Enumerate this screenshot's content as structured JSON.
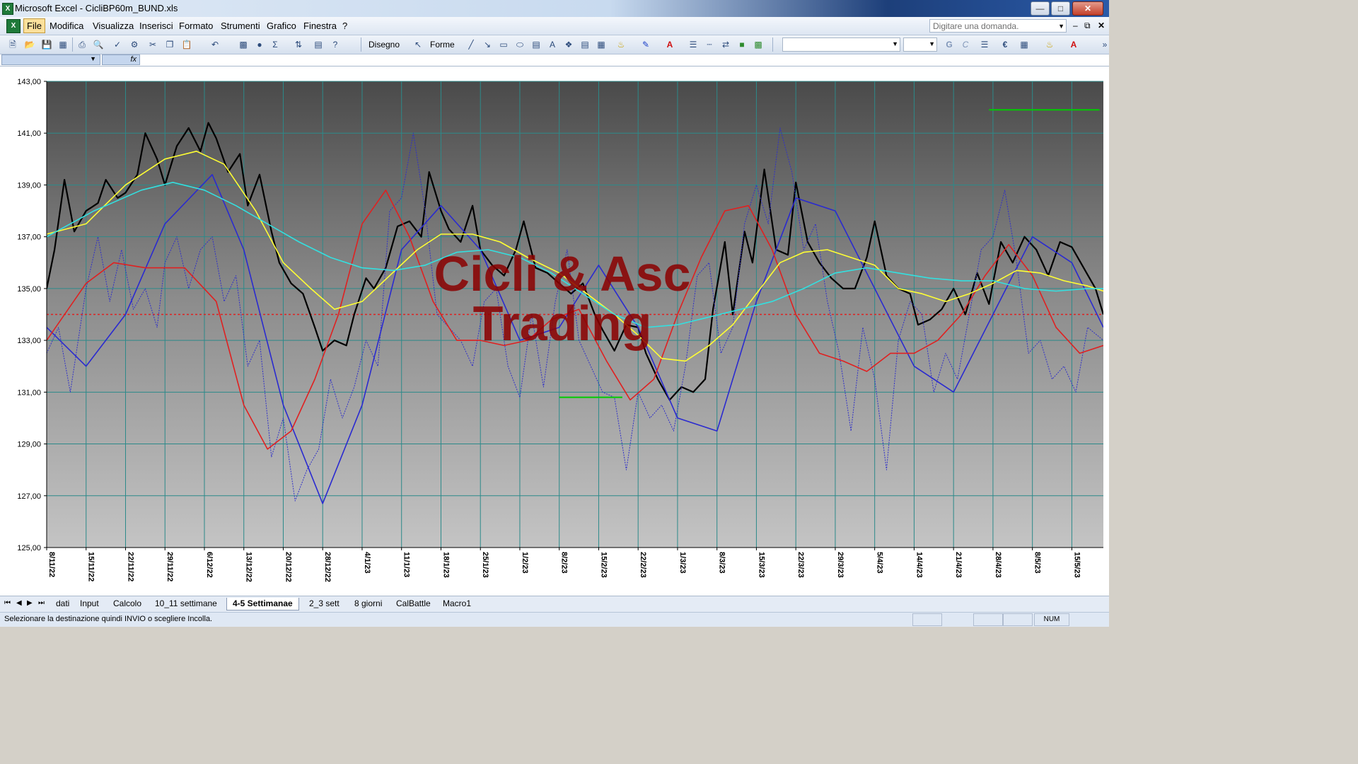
{
  "window": {
    "title": "Microsoft Excel - CicliBP60m_BUND.xls",
    "app_icon": "excel-icon",
    "buttons": [
      "minimize",
      "maximize",
      "close"
    ]
  },
  "menu": {
    "items": [
      "File",
      "Modifica",
      "Visualizza",
      "Inserisci",
      "Formato",
      "Strumenti",
      "Grafico",
      "Finestra",
      "?"
    ],
    "active": "File",
    "help_placeholder": "Digitare una domanda."
  },
  "toolbar": {
    "drawing_label": "Disegno",
    "shapes_label": "Forme"
  },
  "formula_bar": {
    "fx_label": "fx"
  },
  "chart_data": {
    "type": "line",
    "background": "gradient dark-gray top to light-gray bottom",
    "grid": true,
    "legend": "none",
    "ylim": [
      125,
      143
    ],
    "y_ticks": [
      "125,00",
      "127,00",
      "129,00",
      "131,00",
      "133,00",
      "135,00",
      "137,00",
      "139,00",
      "141,00",
      "143,00"
    ],
    "x_ticks": [
      "8/11/22",
      "15/11/22",
      "22/11/22",
      "29/11/22",
      "6/12/22",
      "13/12/22",
      "20/12/22",
      "28/12/22",
      "4/1/23",
      "11/1/23",
      "18/1/23",
      "25/1/23",
      "1/2/23",
      "8/2/23",
      "15/2/23",
      "22/2/23",
      "1/3/23",
      "8/3/23",
      "15/3/23",
      "22/3/23",
      "29/3/23",
      "5/4/23",
      "14/4/23",
      "21/4/23",
      "28/4/23",
      "8/5/23",
      "15/5/23"
    ],
    "x_positions_index": [
      0,
      1,
      2,
      3,
      4,
      5,
      6,
      7,
      8,
      9,
      10,
      11,
      12,
      13,
      14,
      15,
      16,
      17,
      18,
      19,
      20,
      21,
      22,
      23,
      24,
      25,
      26
    ],
    "x_range_index": [
      0,
      26.8
    ],
    "annotation_text": [
      "Cicli & Asc",
      "Trading"
    ],
    "reference_line": {
      "value": 134.0,
      "color": "#e02020",
      "style": "dashed"
    },
    "green_segments": [
      {
        "x": [
          13.0,
          14.6
        ],
        "y": 130.8,
        "color": "#00cc00"
      },
      {
        "x": [
          23.9,
          26.7
        ],
        "y": 141.9,
        "color": "#00cc00"
      }
    ],
    "series": [
      {
        "color": "#000000",
        "style": "solid",
        "role": "price",
        "x": [
          0,
          0.2,
          0.45,
          0.7,
          1.0,
          1.3,
          1.5,
          1.8,
          2.0,
          2.3,
          2.5,
          2.8,
          3.0,
          3.3,
          3.6,
          3.9,
          4.1,
          4.3,
          4.6,
          4.9,
          5.1,
          5.4,
          5.7,
          5.9,
          6.2,
          6.5,
          6.8,
          7.0,
          7.3,
          7.6,
          7.8,
          8.1,
          8.3,
          8.6,
          8.9,
          9.2,
          9.5,
          9.7,
          10.0,
          10.2,
          10.5,
          10.8,
          11.0,
          11.3,
          11.6,
          11.9,
          12.1,
          12.4,
          12.7,
          13.0,
          13.3,
          13.6,
          13.9,
          14.1,
          14.4,
          14.7,
          15.0,
          15.2,
          15.5,
          15.8,
          16.1,
          16.4,
          16.7,
          16.9,
          17.2,
          17.4,
          17.7,
          17.9,
          18.2,
          18.5,
          18.8,
          19.0,
          19.3,
          19.6,
          19.9,
          20.2,
          20.5,
          20.8,
          21.0,
          21.3,
          21.6,
          21.9,
          22.1,
          22.4,
          22.7,
          23.0,
          23.3,
          23.6,
          23.9,
          24.2,
          24.5,
          24.8,
          25.1,
          25.4,
          25.7,
          26.0,
          26.3,
          26.6,
          26.8
        ],
        "y": [
          135.0,
          136.5,
          139.2,
          137.2,
          138.0,
          138.3,
          139.2,
          138.5,
          138.7,
          139.4,
          141.0,
          140.0,
          139.0,
          140.5,
          141.2,
          140.3,
          141.4,
          140.8,
          139.5,
          140.2,
          138.2,
          139.4,
          137.2,
          136.0,
          135.2,
          134.8,
          133.5,
          132.6,
          133.0,
          132.8,
          134.0,
          135.4,
          135.0,
          135.8,
          137.4,
          137.6,
          137.0,
          139.5,
          138.0,
          137.3,
          136.8,
          138.2,
          136.5,
          135.9,
          135.5,
          136.5,
          137.6,
          135.8,
          135.6,
          135.2,
          134.8,
          135.2,
          134.0,
          133.4,
          132.6,
          133.6,
          133.5,
          132.5,
          131.5,
          130.7,
          131.2,
          131.0,
          131.5,
          134.2,
          136.8,
          134.0,
          137.2,
          136.0,
          139.6,
          136.5,
          136.3,
          139.1,
          136.8,
          136.0,
          135.4,
          135.0,
          135.0,
          136.2,
          137.6,
          135.5,
          135.0,
          134.8,
          133.6,
          133.8,
          134.2,
          135.0,
          134.0,
          135.6,
          134.4,
          136.8,
          136.0,
          137.0,
          136.5,
          135.5,
          136.8,
          136.6,
          135.8,
          135.0,
          134.0
        ]
      },
      {
        "color": "#3030c8",
        "style": "dotted",
        "role": "oscillator-fast",
        "x": [
          0,
          0.3,
          0.6,
          1.0,
          1.3,
          1.6,
          1.9,
          2.2,
          2.5,
          2.8,
          3.0,
          3.3,
          3.6,
          3.9,
          4.2,
          4.5,
          4.8,
          5.1,
          5.4,
          5.7,
          6.0,
          6.3,
          6.6,
          6.9,
          7.2,
          7.5,
          7.8,
          8.1,
          8.4,
          8.7,
          9.0,
          9.3,
          9.6,
          9.9,
          10.2,
          10.5,
          10.8,
          11.1,
          11.4,
          11.7,
          12.0,
          12.3,
          12.6,
          12.9,
          13.2,
          13.5,
          13.8,
          14.1,
          14.4,
          14.7,
          15.0,
          15.3,
          15.6,
          15.9,
          16.2,
          16.5,
          16.8,
          17.1,
          17.4,
          17.7,
          18.0,
          18.3,
          18.6,
          18.9,
          19.2,
          19.5,
          19.8,
          20.1,
          20.4,
          20.7,
          21.0,
          21.3,
          21.6,
          21.9,
          22.2,
          22.5,
          22.8,
          23.1,
          23.4,
          23.7,
          24.0,
          24.3,
          24.6,
          24.9,
          25.2,
          25.5,
          25.8,
          26.1,
          26.4,
          26.8
        ],
        "y": [
          132.5,
          133.5,
          131.0,
          135.0,
          137.0,
          134.5,
          136.5,
          134.2,
          135.0,
          133.5,
          136.0,
          137.0,
          135.0,
          136.5,
          137.0,
          134.5,
          135.5,
          132.0,
          133.0,
          128.5,
          130.0,
          126.8,
          128.0,
          128.8,
          131.5,
          130.0,
          131.2,
          133.0,
          132.0,
          138.0,
          138.5,
          141.0,
          138.0,
          134.0,
          133.5,
          133.0,
          132.0,
          134.5,
          135.0,
          132.0,
          130.8,
          134.0,
          131.2,
          134.5,
          136.5,
          133.0,
          132.0,
          131.0,
          130.8,
          128.0,
          131.0,
          130.0,
          130.5,
          129.5,
          132.0,
          135.5,
          136.0,
          132.5,
          133.5,
          137.5,
          139.0,
          137.5,
          141.2,
          139.5,
          136.5,
          137.5,
          134.5,
          132.5,
          129.5,
          133.5,
          131.5,
          128.0,
          133.0,
          134.5,
          134.0,
          131.0,
          132.5,
          131.5,
          134.0,
          136.5,
          137.0,
          138.8,
          136.0,
          132.5,
          133.0,
          131.5,
          132.0,
          131.0,
          133.5,
          133.0
        ]
      },
      {
        "color": "#2a2ad0",
        "style": "solid",
        "role": "cycle",
        "x": [
          0,
          1.0,
          2.0,
          3.0,
          4.2,
          5.0,
          6.0,
          7.0,
          8.0,
          9.0,
          10.0,
          11.0,
          12.0,
          13.0,
          14.0,
          15.0,
          16.0,
          17.0,
          18.0,
          19.0,
          20.0,
          21.0,
          22.0,
          23.0,
          24.0,
          25.0,
          26.0,
          26.8
        ],
        "y": [
          133.5,
          132.0,
          134.0,
          137.5,
          139.4,
          136.5,
          130.5,
          126.7,
          130.5,
          136.5,
          138.2,
          136.5,
          133.0,
          133.5,
          135.9,
          133.5,
          130.0,
          129.5,
          134.5,
          138.5,
          138.0,
          135.0,
          132.0,
          131.0,
          134.0,
          137.0,
          136.0,
          133.5
        ]
      },
      {
        "color": "#e02020",
        "style": "solid",
        "role": "oscillator-mid",
        "x": [
          0,
          1.0,
          1.7,
          2.5,
          3.5,
          4.3,
          5.0,
          5.6,
          6.2,
          6.8,
          7.4,
          8.0,
          8.6,
          9.2,
          9.8,
          10.4,
          11.0,
          11.6,
          12.2,
          12.8,
          13.5,
          14.2,
          14.8,
          15.4,
          16.0,
          16.6,
          17.2,
          17.8,
          18.4,
          19.0,
          19.6,
          20.2,
          20.8,
          21.4,
          22.0,
          22.6,
          23.2,
          23.8,
          24.4,
          25.0,
          25.6,
          26.2,
          26.8
        ],
        "y": [
          133.0,
          135.2,
          136.0,
          135.8,
          135.8,
          134.5,
          130.5,
          128.8,
          129.5,
          131.5,
          134.0,
          137.5,
          138.8,
          137.0,
          134.5,
          133.0,
          133.0,
          132.8,
          133.0,
          133.8,
          134.2,
          132.2,
          130.7,
          131.5,
          134.0,
          136.2,
          138.0,
          138.2,
          136.5,
          134.0,
          132.5,
          132.2,
          131.8,
          132.5,
          132.5,
          133.0,
          134.0,
          135.5,
          136.7,
          135.5,
          133.5,
          132.5,
          132.8
        ]
      },
      {
        "color": "#ffff33",
        "style": "solid",
        "role": "moving-average-fast",
        "x": [
          0,
          1.0,
          2.0,
          3.0,
          3.8,
          4.5,
          5.3,
          6.0,
          6.7,
          7.3,
          8.0,
          8.7,
          9.4,
          10.0,
          10.8,
          11.5,
          12.2,
          13.0,
          13.7,
          14.4,
          15.0,
          15.6,
          16.2,
          16.8,
          17.4,
          18.0,
          18.6,
          19.2,
          19.8,
          20.4,
          21.0,
          21.6,
          22.2,
          22.8,
          23.4,
          24.0,
          24.6,
          25.2,
          25.8,
          26.4,
          26.8
        ],
        "y": [
          137.1,
          137.5,
          139.0,
          140.0,
          140.3,
          139.8,
          138.0,
          136.0,
          135.0,
          134.2,
          134.5,
          135.5,
          136.5,
          137.1,
          137.1,
          136.8,
          136.2,
          135.6,
          134.8,
          134.0,
          133.2,
          132.3,
          132.2,
          132.8,
          133.6,
          134.8,
          136.0,
          136.4,
          136.5,
          136.2,
          135.9,
          135.0,
          134.8,
          134.5,
          134.8,
          135.2,
          135.7,
          135.6,
          135.3,
          135.1,
          134.9
        ]
      },
      {
        "color": "#33e0e0",
        "style": "solid",
        "role": "moving-average-slow",
        "x": [
          0,
          1.2,
          2.4,
          3.2,
          4.0,
          4.8,
          5.6,
          6.4,
          7.2,
          8.0,
          8.8,
          9.6,
          10.4,
          11.2,
          12.0,
          12.8,
          13.6,
          14.4,
          15.2,
          16.0,
          16.8,
          17.6,
          18.4,
          19.2,
          20.0,
          20.8,
          21.6,
          22.4,
          23.2,
          24.0,
          24.8,
          25.6,
          26.4,
          26.8
        ],
        "y": [
          137.0,
          138.0,
          138.8,
          139.1,
          138.8,
          138.2,
          137.5,
          136.8,
          136.2,
          135.8,
          135.7,
          135.9,
          136.4,
          136.5,
          136.2,
          135.6,
          134.8,
          134.0,
          133.5,
          133.6,
          133.9,
          134.2,
          134.5,
          135.0,
          135.6,
          135.8,
          135.6,
          135.4,
          135.3,
          135.3,
          135.0,
          134.9,
          135.0,
          135.0
        ]
      }
    ]
  },
  "sheet_tabs": {
    "tabs": [
      "dati",
      "Input",
      "Calcolo",
      "10_11 settimane",
      "4-5 Settimanae",
      "2_3 sett",
      "8 giorni",
      "CalBattle",
      "Macro1"
    ],
    "active": "4-5 Settimanae"
  },
  "status": {
    "message": "Selezionare la destinazione quindi INVIO o scegliere Incolla.",
    "num": "NUM"
  }
}
